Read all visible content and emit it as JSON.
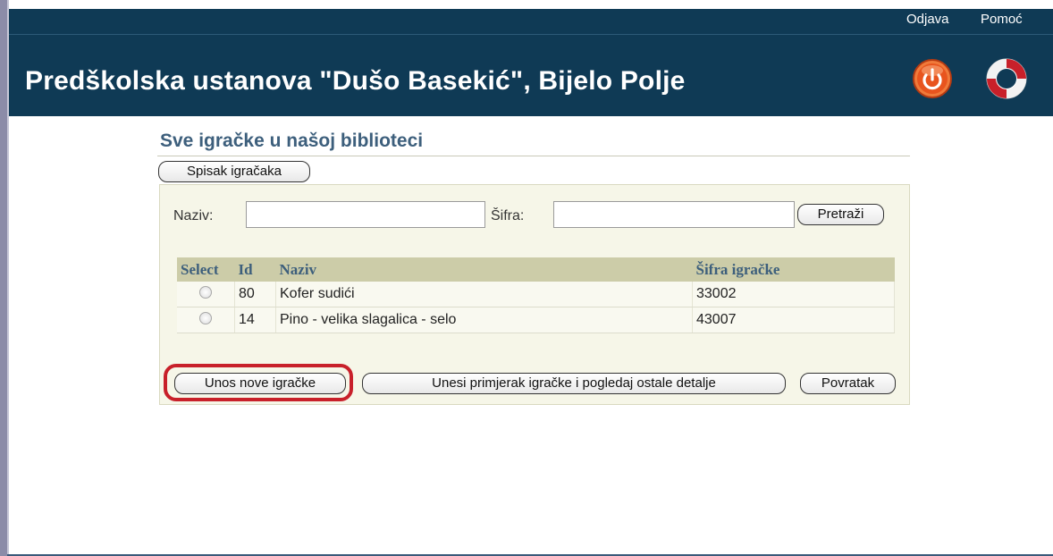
{
  "header": {
    "title": "Predškolska ustanova \"Dušo Basekić\", Bijelo Polje",
    "links": {
      "logout": "Odjava",
      "help": "Pomoć"
    },
    "icons": {
      "logout": "power-icon",
      "help": "lifebuoy-icon"
    },
    "colors": {
      "background": "#0f3a55",
      "logout_icon": "#e8541e",
      "lifebuoy_red": "#c8202a"
    }
  },
  "page": {
    "heading": "Sve igračke u našoj biblioteci",
    "list_button": "Spisak igračaka"
  },
  "search": {
    "naziv_label": "Naziv:",
    "naziv_value": "",
    "sifra_label": "Šifra:",
    "sifra_value": "",
    "button": "Pretraži"
  },
  "table": {
    "columns": [
      "Select",
      "Id",
      "Naziv",
      "Šifra igračke"
    ],
    "rows": [
      {
        "id": "80",
        "naziv": "Kofer sudići",
        "sifra": "33002"
      },
      {
        "id": "14",
        "naziv": "Pino - velika slagalica - selo",
        "sifra": "43007"
      }
    ]
  },
  "actions": {
    "new_toy": "Unos nove igračke",
    "details": "Unesi primjerak igračke i pogledaj ostale detalje",
    "back": "Povratak"
  },
  "colors": {
    "highlight": "#c8202a",
    "accent_text": "#3d5f7c",
    "table_header": "#cccca8"
  }
}
